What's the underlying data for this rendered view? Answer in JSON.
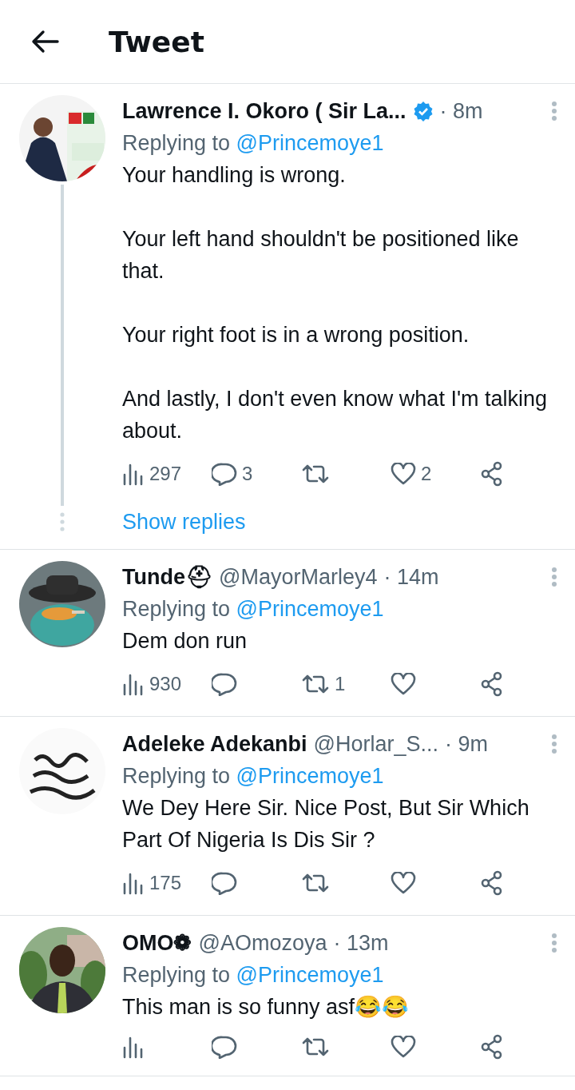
{
  "header": {
    "title": "Tweet"
  },
  "tweets": [
    {
      "name": "Lawrence I. Okoro ( Sir La...",
      "verified": true,
      "time": "· 8m",
      "replying_label": "Replying to",
      "replying_to": "@Princemoye1",
      "text": "Your handling is wrong.\n\nYour left hand shouldn't be positioned like that.\n\nYour right foot is in a wrong position.\n\nAnd lastly, I don't even know what I'm talking about.",
      "views": "297",
      "replies": "3",
      "likes": "2",
      "thread": true,
      "show_replies": "Show replies"
    },
    {
      "name": "Tunde⛑",
      "verified": false,
      "handle": "@MayorMarley4",
      "time": "· 14m",
      "replying_label": "Replying to",
      "replying_to": "@Princemoye1",
      "text": "Dem don run",
      "views": "930",
      "retweets": "1",
      "thread": false
    },
    {
      "name": "Adeleke Adekanbi",
      "verified": false,
      "handle": "@Horlar_S...",
      "time": "· 9m",
      "replying_label": "Replying to",
      "replying_to": "@Princemoye1",
      "text": "We Dey Here Sir. Nice Post, But Sir Which Part Of Nigeria Is Dis Sir ?",
      "views": "175",
      "thread": false
    },
    {
      "name": "OMO❁",
      "verified": false,
      "handle": "@AOmozoya",
      "time": "· 13m",
      "replying_label": "Replying to",
      "replying_to": "@Princemoye1",
      "text": "This man is so funny asf😂😂",
      "thread": false
    }
  ]
}
